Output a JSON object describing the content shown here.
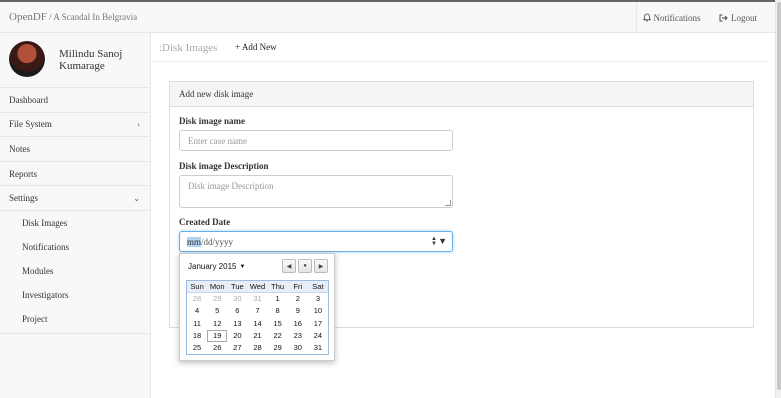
{
  "navbar": {
    "brand": "OpenDF",
    "separator": " / ",
    "case": "A Scandal In Belgravia",
    "notifications": "Notifications",
    "logout": "Logout"
  },
  "user": {
    "name": "Milindu Sanoj Kumarage"
  },
  "sidebar": {
    "items": [
      {
        "label": "Dashboard"
      },
      {
        "label": "File System",
        "caret": "‹"
      },
      {
        "label": "Notes"
      },
      {
        "label": "Reports"
      },
      {
        "label": "Settings",
        "caret": "⌄"
      }
    ],
    "settings_sub": [
      {
        "label": "Disk Images"
      },
      {
        "label": "Notifications"
      },
      {
        "label": "Modules"
      },
      {
        "label": "Investigators"
      },
      {
        "label": "Project"
      }
    ]
  },
  "page": {
    "title": ":Disk Images",
    "add_new": "+ Add New"
  },
  "form": {
    "heading": "Add new disk image",
    "name_label": "Disk image name",
    "name_placeholder": "Enter case name",
    "desc_label": "Disk image Description",
    "desc_placeholder": "Disk image Description",
    "date_label": "Created Date",
    "date_sel": "mm",
    "date_rest": "/dd/yyyy"
  },
  "calendar": {
    "month": "January 2015",
    "weekdays": [
      "Sun",
      "Mon",
      "Tue",
      "Wed",
      "Thu",
      "Fri",
      "Sat"
    ],
    "weeks": [
      [
        "28",
        "29",
        "30",
        "31",
        "1",
        "2",
        "3"
      ],
      [
        "4",
        "5",
        "6",
        "7",
        "8",
        "9",
        "10"
      ],
      [
        "11",
        "12",
        "13",
        "14",
        "15",
        "16",
        "17"
      ],
      [
        "18",
        "19",
        "20",
        "21",
        "22",
        "23",
        "24"
      ],
      [
        "25",
        "26",
        "27",
        "28",
        "29",
        "30",
        "31"
      ]
    ],
    "today": "19"
  }
}
